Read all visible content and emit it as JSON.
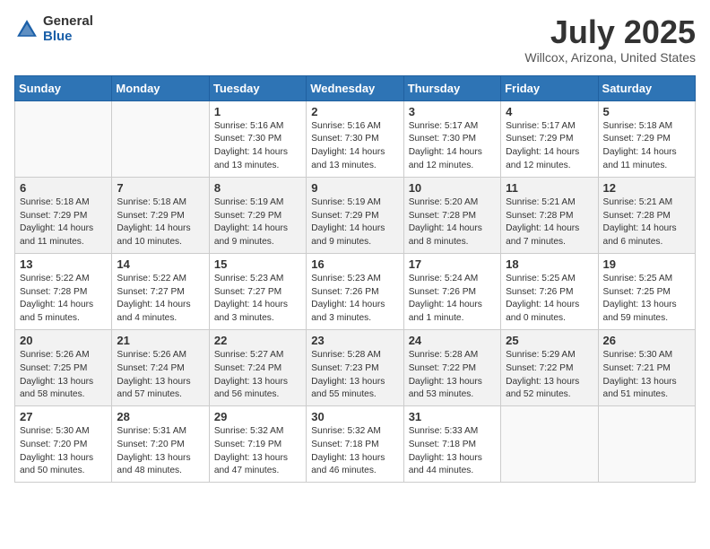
{
  "header": {
    "logo_general": "General",
    "logo_blue": "Blue",
    "month_title": "July 2025",
    "location": "Willcox, Arizona, United States"
  },
  "days_of_week": [
    "Sunday",
    "Monday",
    "Tuesday",
    "Wednesday",
    "Thursday",
    "Friday",
    "Saturday"
  ],
  "weeks": [
    [
      {
        "day": "",
        "info": ""
      },
      {
        "day": "",
        "info": ""
      },
      {
        "day": "1",
        "info": "Sunrise: 5:16 AM\nSunset: 7:30 PM\nDaylight: 14 hours and 13 minutes."
      },
      {
        "day": "2",
        "info": "Sunrise: 5:16 AM\nSunset: 7:30 PM\nDaylight: 14 hours and 13 minutes."
      },
      {
        "day": "3",
        "info": "Sunrise: 5:17 AM\nSunset: 7:30 PM\nDaylight: 14 hours and 12 minutes."
      },
      {
        "day": "4",
        "info": "Sunrise: 5:17 AM\nSunset: 7:29 PM\nDaylight: 14 hours and 12 minutes."
      },
      {
        "day": "5",
        "info": "Sunrise: 5:18 AM\nSunset: 7:29 PM\nDaylight: 14 hours and 11 minutes."
      }
    ],
    [
      {
        "day": "6",
        "info": "Sunrise: 5:18 AM\nSunset: 7:29 PM\nDaylight: 14 hours and 11 minutes."
      },
      {
        "day": "7",
        "info": "Sunrise: 5:18 AM\nSunset: 7:29 PM\nDaylight: 14 hours and 10 minutes."
      },
      {
        "day": "8",
        "info": "Sunrise: 5:19 AM\nSunset: 7:29 PM\nDaylight: 14 hours and 9 minutes."
      },
      {
        "day": "9",
        "info": "Sunrise: 5:19 AM\nSunset: 7:29 PM\nDaylight: 14 hours and 9 minutes."
      },
      {
        "day": "10",
        "info": "Sunrise: 5:20 AM\nSunset: 7:28 PM\nDaylight: 14 hours and 8 minutes."
      },
      {
        "day": "11",
        "info": "Sunrise: 5:21 AM\nSunset: 7:28 PM\nDaylight: 14 hours and 7 minutes."
      },
      {
        "day": "12",
        "info": "Sunrise: 5:21 AM\nSunset: 7:28 PM\nDaylight: 14 hours and 6 minutes."
      }
    ],
    [
      {
        "day": "13",
        "info": "Sunrise: 5:22 AM\nSunset: 7:28 PM\nDaylight: 14 hours and 5 minutes."
      },
      {
        "day": "14",
        "info": "Sunrise: 5:22 AM\nSunset: 7:27 PM\nDaylight: 14 hours and 4 minutes."
      },
      {
        "day": "15",
        "info": "Sunrise: 5:23 AM\nSunset: 7:27 PM\nDaylight: 14 hours and 3 minutes."
      },
      {
        "day": "16",
        "info": "Sunrise: 5:23 AM\nSunset: 7:26 PM\nDaylight: 14 hours and 3 minutes."
      },
      {
        "day": "17",
        "info": "Sunrise: 5:24 AM\nSunset: 7:26 PM\nDaylight: 14 hours and 1 minute."
      },
      {
        "day": "18",
        "info": "Sunrise: 5:25 AM\nSunset: 7:26 PM\nDaylight: 14 hours and 0 minutes."
      },
      {
        "day": "19",
        "info": "Sunrise: 5:25 AM\nSunset: 7:25 PM\nDaylight: 13 hours and 59 minutes."
      }
    ],
    [
      {
        "day": "20",
        "info": "Sunrise: 5:26 AM\nSunset: 7:25 PM\nDaylight: 13 hours and 58 minutes."
      },
      {
        "day": "21",
        "info": "Sunrise: 5:26 AM\nSunset: 7:24 PM\nDaylight: 13 hours and 57 minutes."
      },
      {
        "day": "22",
        "info": "Sunrise: 5:27 AM\nSunset: 7:24 PM\nDaylight: 13 hours and 56 minutes."
      },
      {
        "day": "23",
        "info": "Sunrise: 5:28 AM\nSunset: 7:23 PM\nDaylight: 13 hours and 55 minutes."
      },
      {
        "day": "24",
        "info": "Sunrise: 5:28 AM\nSunset: 7:22 PM\nDaylight: 13 hours and 53 minutes."
      },
      {
        "day": "25",
        "info": "Sunrise: 5:29 AM\nSunset: 7:22 PM\nDaylight: 13 hours and 52 minutes."
      },
      {
        "day": "26",
        "info": "Sunrise: 5:30 AM\nSunset: 7:21 PM\nDaylight: 13 hours and 51 minutes."
      }
    ],
    [
      {
        "day": "27",
        "info": "Sunrise: 5:30 AM\nSunset: 7:20 PM\nDaylight: 13 hours and 50 minutes."
      },
      {
        "day": "28",
        "info": "Sunrise: 5:31 AM\nSunset: 7:20 PM\nDaylight: 13 hours and 48 minutes."
      },
      {
        "day": "29",
        "info": "Sunrise: 5:32 AM\nSunset: 7:19 PM\nDaylight: 13 hours and 47 minutes."
      },
      {
        "day": "30",
        "info": "Sunrise: 5:32 AM\nSunset: 7:18 PM\nDaylight: 13 hours and 46 minutes."
      },
      {
        "day": "31",
        "info": "Sunrise: 5:33 AM\nSunset: 7:18 PM\nDaylight: 13 hours and 44 minutes."
      },
      {
        "day": "",
        "info": ""
      },
      {
        "day": "",
        "info": ""
      }
    ]
  ]
}
